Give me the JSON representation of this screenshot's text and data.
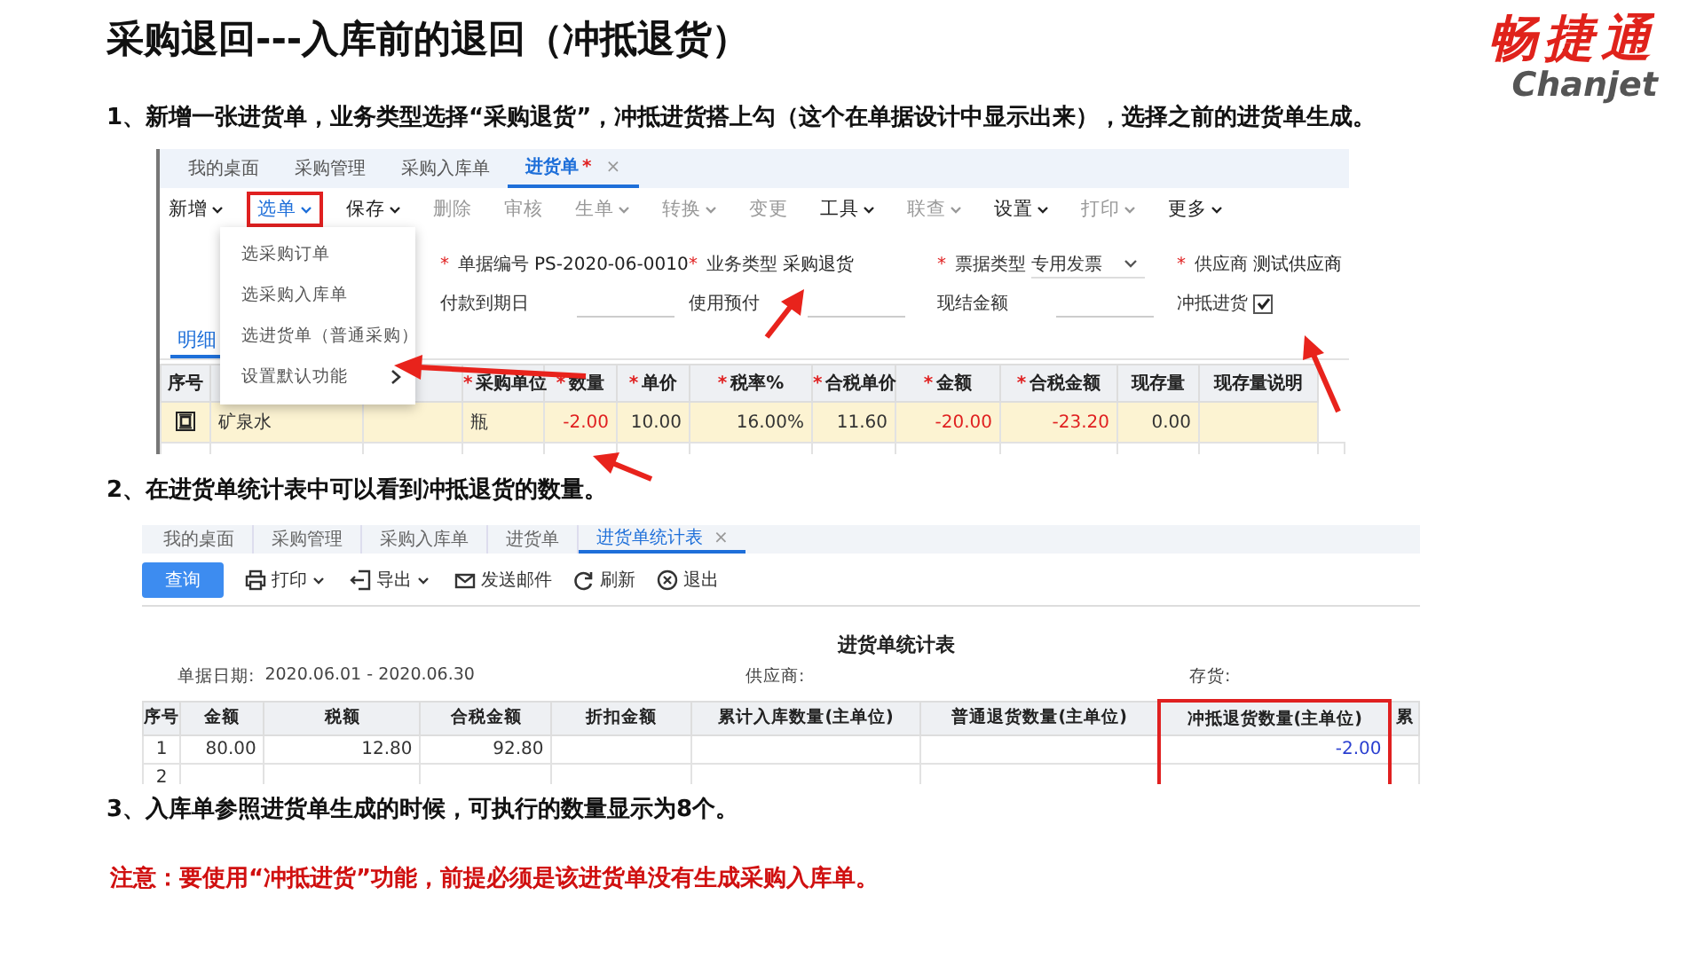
{
  "title": "采购退回---入库前的退回（冲抵退货）",
  "logo": {
    "name": "畅捷通",
    "latin": "Chanjet"
  },
  "step1": "1、新增一张进货单，业务类型选择“采购退货”，冲抵进货搭上勾（这个在单据设计中显示出来），选择之前的进货单生成。",
  "screen1": {
    "tabs": [
      {
        "label": "我的桌面",
        "selected": false
      },
      {
        "label": "采购管理",
        "selected": false
      },
      {
        "label": "采购入库单",
        "selected": false
      },
      {
        "label": "进货单",
        "selected": true,
        "mark": "*",
        "close": "×"
      }
    ],
    "toolbar": [
      {
        "label": "新增",
        "caret": true,
        "disabled": false,
        "highlighted": false
      },
      {
        "label": "选单",
        "caret": true,
        "disabled": false,
        "highlighted": true
      },
      {
        "label": "保存",
        "caret": true,
        "disabled": false,
        "highlighted": false
      },
      {
        "label": "删除",
        "caret": false,
        "disabled": true,
        "highlighted": false
      },
      {
        "label": "审核",
        "caret": false,
        "disabled": true,
        "highlighted": false
      },
      {
        "label": "生单",
        "caret": true,
        "disabled": true,
        "highlighted": false
      },
      {
        "label": "转换",
        "caret": true,
        "disabled": true,
        "highlighted": false
      },
      {
        "label": "变更",
        "caret": false,
        "disabled": true,
        "highlighted": false
      },
      {
        "label": "工具",
        "caret": true,
        "disabled": false,
        "highlighted": false
      },
      {
        "label": "联查",
        "caret": true,
        "disabled": true,
        "highlighted": false
      },
      {
        "label": "设置",
        "caret": true,
        "disabled": false,
        "highlighted": false
      },
      {
        "label": "打印",
        "caret": true,
        "disabled": true,
        "highlighted": false
      },
      {
        "label": "更多",
        "caret": true,
        "disabled": false,
        "highlighted": false
      }
    ],
    "menu": [
      {
        "label": "选采购订单",
        "submenu": false
      },
      {
        "label": "选采购入库单",
        "submenu": false
      },
      {
        "label": "选进货单（普通采购）",
        "submenu": false
      },
      {
        "label": "设置默认功能",
        "submenu": true
      }
    ],
    "form": [
      [
        {
          "kind": "text",
          "req": "*",
          "label": "单据编号",
          "value": "PS-2020-06-0010"
        },
        {
          "kind": "text",
          "req": "*",
          "label": "业务类型",
          "value": "采购退货"
        },
        {
          "kind": "select",
          "req": "*",
          "label": "票据类型",
          "value": "专用发票"
        },
        {
          "kind": "text",
          "req": "*",
          "label": "供应商",
          "value": "测试供应商"
        }
      ],
      [
        {
          "kind": "input",
          "label": "付款到期日"
        },
        {
          "kind": "input",
          "label": "使用预付"
        },
        {
          "kind": "input",
          "label": "现结金额"
        },
        {
          "kind": "checkbox",
          "label": "冲抵进货",
          "checked": true
        }
      ]
    ],
    "detail_tab": {
      "label": "明细",
      "selected": true
    },
    "columns": [
      {
        "label": "序号"
      },
      {},
      {},
      {
        "req": "*",
        "label": "采购单位"
      },
      {
        "req": "*",
        "label": "数量"
      },
      {
        "req": "*",
        "label": "单价"
      },
      {
        "req": "*",
        "label": "税率%"
      },
      {
        "req": "*",
        "label": "合税单价"
      },
      {
        "req": "*",
        "label": "金额"
      },
      {
        "req": "*",
        "label": "合税金额"
      },
      {
        "label": "现存量"
      },
      {
        "label": "现存量说明"
      }
    ],
    "rows": [
      {
        "selected": true,
        "cells": [
          {
            "kind": "icon"
          },
          {
            "kind": "text",
            "text": "矿泉水",
            "color": "#333333"
          },
          {
            "kind": "empty"
          },
          {
            "kind": "text",
            "text": "瓶",
            "color": "#333333"
          },
          {
            "kind": "text",
            "text": "-2.00",
            "color": "#e02020"
          },
          {
            "kind": "text",
            "text": "10.00",
            "color": "#333333"
          },
          {
            "kind": "text",
            "text": "16.00%",
            "color": "#333333"
          },
          {
            "kind": "text",
            "text": "11.60",
            "color": "#333333"
          },
          {
            "kind": "text",
            "text": "-20.00",
            "color": "#e02020"
          },
          {
            "kind": "text",
            "text": "-23.20",
            "color": "#e02020"
          },
          {
            "kind": "text",
            "text": "0.00",
            "color": "#333333"
          },
          {
            "kind": "empty"
          }
        ]
      }
    ]
  },
  "step2": "2、在进货单统计表中可以看到冲抵退货的数量。",
  "screen2": {
    "tabs": [
      {
        "label": "我的桌面",
        "selected": false
      },
      {
        "label": "采购管理",
        "selected": false
      },
      {
        "label": "采购入库单",
        "selected": false
      },
      {
        "label": "进货单",
        "selected": false
      },
      {
        "label": "进货单统计表",
        "selected": true,
        "close": "×"
      }
    ],
    "toolbar": [
      {
        "kind": "primary",
        "label": "查询"
      },
      {
        "kind": "print",
        "label": "打印",
        "caret": true
      },
      {
        "kind": "export",
        "label": "导出",
        "caret": true
      },
      {
        "kind": "mail",
        "label": "发送邮件",
        "caret": false
      },
      {
        "kind": "refresh",
        "label": "刷新",
        "caret": false
      },
      {
        "kind": "exit",
        "label": "退出",
        "caret": false
      }
    ],
    "report_title": "进货单统计表",
    "filters": [
      {
        "label": "单据日期:",
        "value": "2020.06.01 - 2020.06.30"
      },
      {
        "label": "供应商:"
      },
      {
        "label": "存货:"
      }
    ],
    "columns": [
      {
        "label": "序号",
        "highlighted": false
      },
      {
        "label": "金额",
        "highlighted": false
      },
      {
        "label": "税额",
        "highlighted": false
      },
      {
        "label": "合税金额",
        "highlighted": false
      },
      {
        "label": "折扣金额",
        "highlighted": false
      },
      {
        "label": "累计入库数量(主单位)",
        "highlighted": false
      },
      {
        "label": "普通退货数量(主单位)",
        "highlighted": false
      },
      {
        "label": "冲抵退货数量(主单位)",
        "highlighted": true
      },
      {
        "label": "累",
        "highlighted": false
      }
    ],
    "rows": [
      {
        "cells": [
          {
            "text": "1",
            "color": "#333333"
          },
          {
            "text": "80.00",
            "color": "#333333"
          },
          {
            "text": "12.80",
            "color": "#333333"
          },
          {
            "text": "92.80",
            "color": "#333333"
          },
          {},
          {},
          {},
          {
            "text": "-2.00",
            "color": "#2a3fd0"
          },
          {}
        ]
      },
      {
        "cells": [
          {
            "text": "2",
            "color": "#333333"
          },
          {},
          {},
          {},
          {},
          {},
          {},
          {},
          {}
        ]
      }
    ]
  },
  "step3": "3、入库单参照进货单生成的时候，可执行的数量显示为8个。",
  "note": "注意：要使用“冲抵进货”功能，前提必须是该进货单没有生成采购入库单。"
}
